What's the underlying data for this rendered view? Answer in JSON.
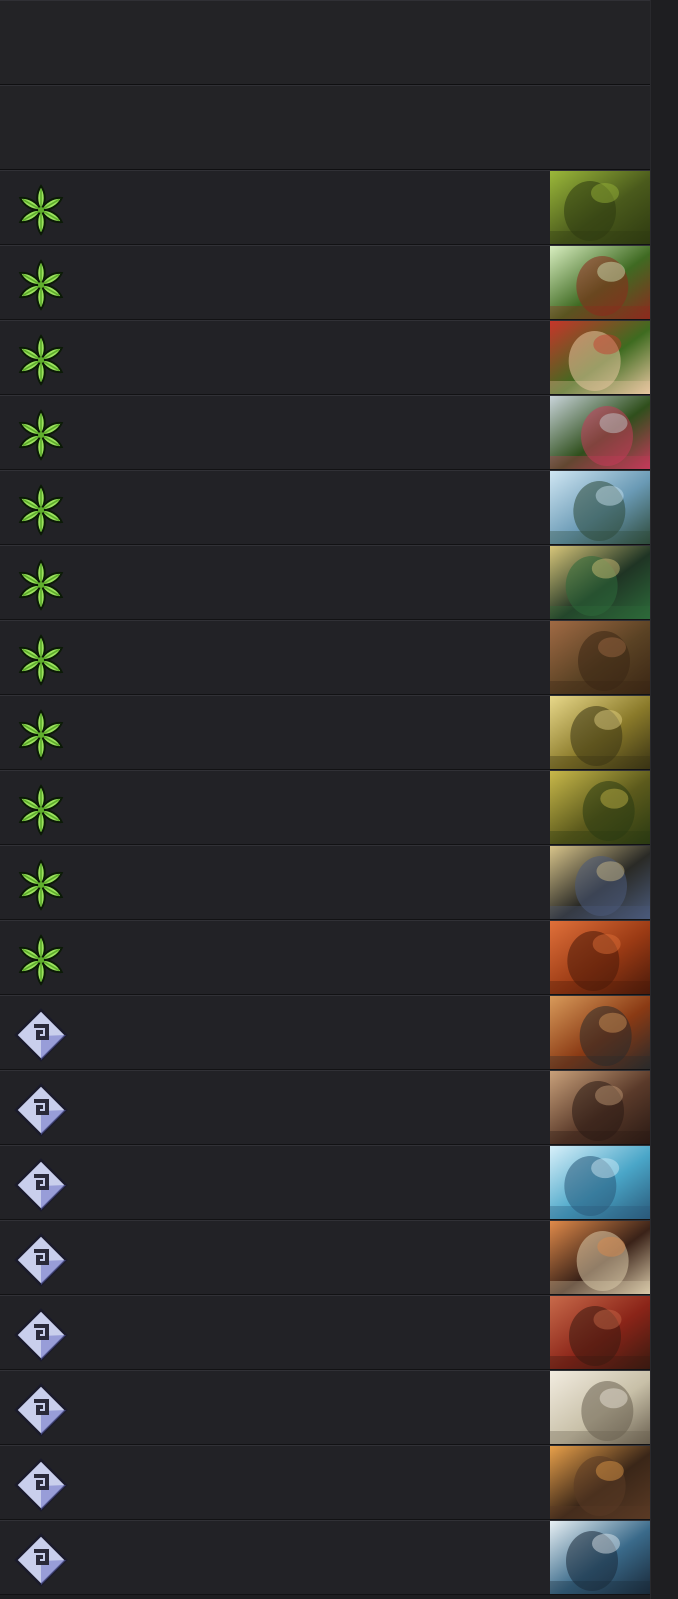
{
  "header_rows": 2,
  "icons": {
    "nature": {
      "name": "nature-faction-icon",
      "fill": "#9be35e",
      "fill_dark": "#5fae2c"
    },
    "control": {
      "name": "control-faction-icon",
      "fill": "#c9cfec",
      "fill_dark": "#6f75c9"
    }
  },
  "cards": [
    {
      "faction": "nature",
      "art": {
        "bg": "#4a5a1c",
        "accent": "#9bb83a",
        "shape": "#2e3a10"
      }
    },
    {
      "faction": "nature",
      "art": {
        "bg": "#3f6a22",
        "accent": "#d8eec0",
        "shape": "#8c2a1e"
      }
    },
    {
      "faction": "nature",
      "art": {
        "bg": "#3e6b20",
        "accent": "#c7352a",
        "shape": "#e8c6a0"
      }
    },
    {
      "faction": "nature",
      "art": {
        "bg": "#2f4f1c",
        "accent": "#c9d4da",
        "shape": "#c43a5a"
      }
    },
    {
      "faction": "nature",
      "art": {
        "bg": "#6a9ab5",
        "accent": "#cfe6f3",
        "shape": "#2e4a3a"
      }
    },
    {
      "faction": "nature",
      "art": {
        "bg": "#1f3424",
        "accent": "#d8c67a",
        "shape": "#2d6a3a"
      }
    },
    {
      "faction": "nature",
      "art": {
        "bg": "#5a4224",
        "accent": "#a06a44",
        "shape": "#3a2614"
      }
    },
    {
      "faction": "nature",
      "art": {
        "bg": "#8a7a2a",
        "accent": "#e8d88a",
        "shape": "#3a3414"
      }
    },
    {
      "faction": "nature",
      "art": {
        "bg": "#5c5a1c",
        "accent": "#c8b84a",
        "shape": "#2a3a12"
      }
    },
    {
      "faction": "nature",
      "art": {
        "bg": "#2a2a26",
        "accent": "#d8c48a",
        "shape": "#4a5a7a"
      }
    },
    {
      "faction": "nature",
      "art": {
        "bg": "#9a3a14",
        "accent": "#e0703a",
        "shape": "#4a1a0a"
      }
    },
    {
      "faction": "control",
      "art": {
        "bg": "#8a3a14",
        "accent": "#d89a5a",
        "shape": "#2a2a2a"
      }
    },
    {
      "faction": "control",
      "art": {
        "bg": "#5a3a2a",
        "accent": "#c8a07a",
        "shape": "#2a1a14"
      }
    },
    {
      "faction": "control",
      "art": {
        "bg": "#4aa6c8",
        "accent": "#d8f0fa",
        "shape": "#2a5a7a"
      }
    },
    {
      "faction": "control",
      "art": {
        "bg": "#3a2218",
        "accent": "#e08a4a",
        "shape": "#d8c8a8"
      }
    },
    {
      "faction": "control",
      "art": {
        "bg": "#8a2418",
        "accent": "#c86a4a",
        "shape": "#3a1a10"
      }
    },
    {
      "faction": "control",
      "art": {
        "bg": "#c8c0a8",
        "accent": "#f2ece0",
        "shape": "#6a6050"
      }
    },
    {
      "faction": "control",
      "art": {
        "bg": "#3a2618",
        "accent": "#e8a04a",
        "shape": "#5a3a24"
      }
    },
    {
      "faction": "control",
      "art": {
        "bg": "#3a6a8a",
        "accent": "#e8f0f4",
        "shape": "#1a2a3a"
      }
    }
  ]
}
